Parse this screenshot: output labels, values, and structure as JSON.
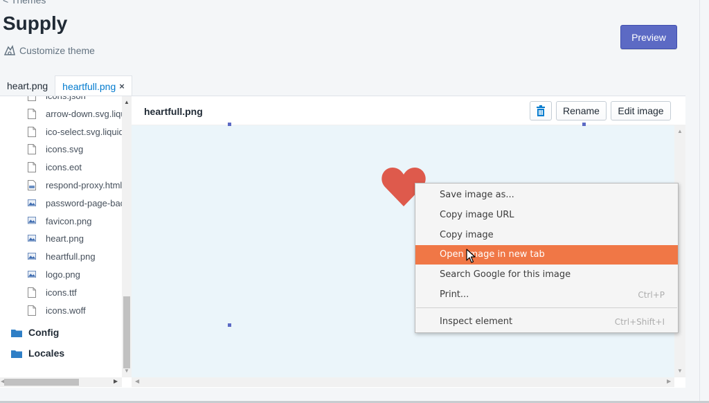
{
  "header": {
    "back_label": "< Themes",
    "title": "Supply",
    "customize_label": "Customize theme",
    "preview_label": "Preview"
  },
  "tabs": [
    {
      "label": "heart.png",
      "active": false
    },
    {
      "label": "heartfull.png",
      "active": true,
      "close": "×"
    }
  ],
  "tree": {
    "files": [
      {
        "label": "icons.json",
        "icon": "file-icon"
      },
      {
        "label": "arrow-down.svg.liquid",
        "icon": "file-icon"
      },
      {
        "label": "ico-select.svg.liquid",
        "icon": "file-icon"
      },
      {
        "label": "icons.svg",
        "icon": "file-icon"
      },
      {
        "label": "icons.eot",
        "icon": "file-icon"
      },
      {
        "label": "respond-proxy.html",
        "icon": "html-file-icon"
      },
      {
        "label": "password-page-background.png",
        "icon": "image-file-icon"
      },
      {
        "label": "favicon.png",
        "icon": "image-file-icon"
      },
      {
        "label": "heart.png",
        "icon": "image-file-icon"
      },
      {
        "label": "heartfull.png",
        "icon": "image-file-icon"
      },
      {
        "label": "logo.png",
        "icon": "image-file-icon"
      },
      {
        "label": "icons.ttf",
        "icon": "file-icon"
      },
      {
        "label": "icons.woff",
        "icon": "file-icon"
      }
    ],
    "folders": [
      {
        "label": "Config"
      },
      {
        "label": "Locales"
      }
    ]
  },
  "editor": {
    "filename": "heartfull.png",
    "rename_label": "Rename",
    "edit_label": "Edit image"
  },
  "context_menu": {
    "items": [
      {
        "label": "Save image as...",
        "shortcut": ""
      },
      {
        "label": "Copy image URL",
        "shortcut": ""
      },
      {
        "label": "Copy image",
        "shortcut": ""
      },
      {
        "label": "Open image in new tab",
        "shortcut": "",
        "hover": true
      },
      {
        "label": "Search Google for this image",
        "shortcut": ""
      },
      {
        "label": "Print...",
        "shortcut": "Ctrl+P"
      },
      {
        "label": "Inspect element",
        "shortcut": "Ctrl+Shift+I"
      }
    ]
  },
  "colors": {
    "accent": "#5c6ac4",
    "link": "#007ace",
    "heart": "#de5a4c",
    "menu_hover": "#f07746",
    "canvas": "#ebf5fa"
  }
}
